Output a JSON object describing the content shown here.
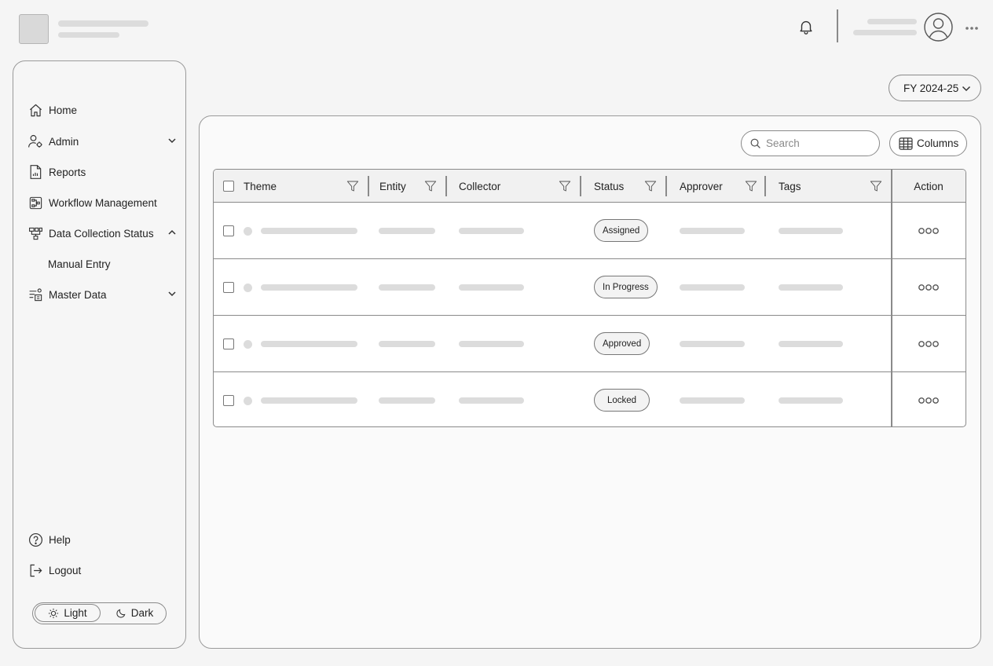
{
  "sidebar": {
    "items": [
      {
        "label": "Home",
        "icon": "home-icon"
      },
      {
        "label": "Admin",
        "icon": "admin-user-gear-icon"
      },
      {
        "label": "Reports",
        "icon": "report-document-icon"
      },
      {
        "label": "Workflow Management",
        "icon": "workflow-icon"
      },
      {
        "label": "Data Collection Status",
        "icon": "data-collection-icon"
      },
      {
        "label": "Manual Entry"
      },
      {
        "label": "Master Data",
        "icon": "master-data-icon"
      }
    ],
    "help_label": "Help",
    "logout_label": "Logout",
    "theme": {
      "light_label": "Light",
      "dark_label": "Dark",
      "selected": "Light"
    }
  },
  "fiscal_year": {
    "selected": "FY 2024-25"
  },
  "toolbar": {
    "search_placeholder": "Search",
    "columns_label": "Columns"
  },
  "table": {
    "columns": [
      "Theme",
      "Entity",
      "Collector",
      "Status",
      "Approver",
      "Tags",
      "Action"
    ],
    "rows": [
      {
        "status": "Assigned"
      },
      {
        "status": "In Progress"
      },
      {
        "status": "Approved"
      },
      {
        "status": "Locked"
      }
    ]
  },
  "colors": {
    "background": "#f5f5f5",
    "border": "#8a8a8a",
    "placeholder": "#dcdcdc"
  }
}
